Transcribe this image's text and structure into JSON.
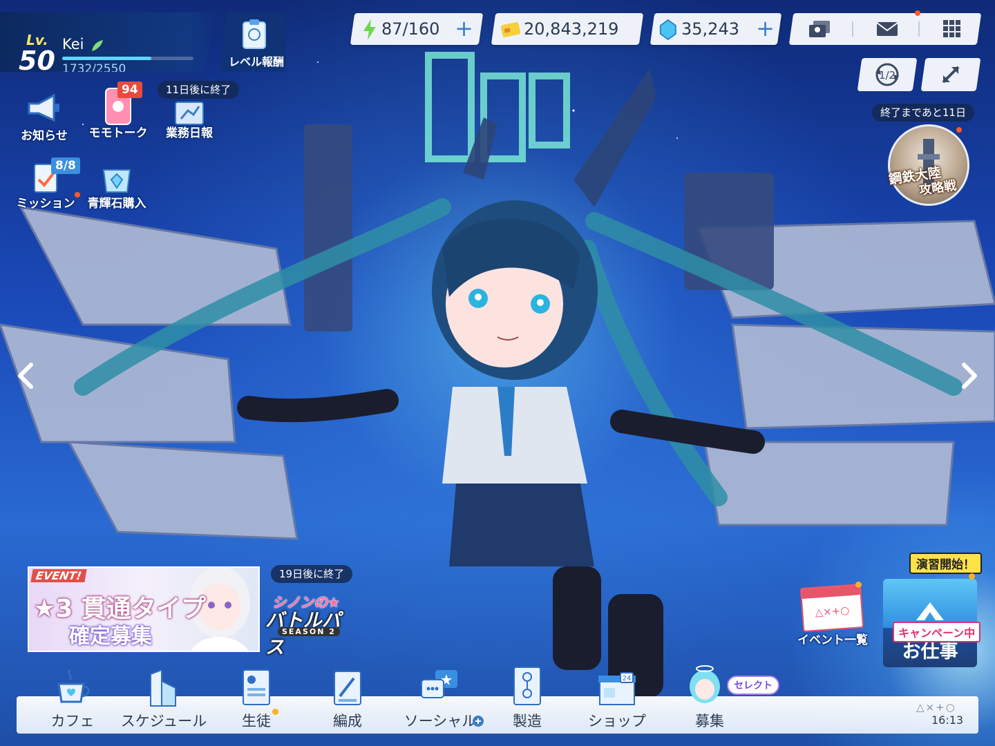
{
  "profile": {
    "lv_label": "Lv.",
    "level": "50",
    "name": "Kei",
    "exp_text": "1732/2550",
    "exp_fraction": 0.679
  },
  "level_reward": {
    "label": "レベル報酬"
  },
  "resources": {
    "ap": {
      "value": "87/160",
      "icon": "lightning-icon"
    },
    "credits": {
      "value": "20,843,219",
      "icon": "credit-card-icon"
    },
    "pyroxene": {
      "value": "35,243",
      "icon": "crystal-icon"
    }
  },
  "quick_icons": {
    "notice": {
      "label": "お知らせ"
    },
    "momotalk": {
      "label": "モモトーク",
      "badge": "94"
    },
    "daily_report": {
      "label": "業務日報",
      "pill": "11日後に終了"
    },
    "mission": {
      "label": "ミッション",
      "badge": "8/8"
    },
    "pyroxene_shop": {
      "label": "青輝石購入"
    }
  },
  "event_right": {
    "pill": "終了まであと11日",
    "title_1": "鋼鉄大陸",
    "title_2": "攻略戦"
  },
  "banner": {
    "tag": "EVENT!",
    "line1": "★3 貫通タイプ",
    "line2": "確定募集"
  },
  "battle_pass": {
    "pill": "19日後に終了",
    "line1": "シノンの★",
    "line2": "バトルパス",
    "season": "SEASON 2"
  },
  "event_list": {
    "label": "イベント一覧",
    "calendar_symbols": "△×+○"
  },
  "job": {
    "ribbon": "演習開始！",
    "campaign": "キャンペーン中",
    "label": "お仕事"
  },
  "nav": {
    "cafe": "カフェ",
    "schedule": "スケジュール",
    "students": "生徒",
    "formation": "編成",
    "social": "ソーシャル",
    "craft": "製造",
    "shop": "ショップ",
    "recruit": "募集",
    "recruit_tag": "セレクト",
    "shop_day": "24",
    "symbols": "△×+○",
    "time": "16:13"
  },
  "colors": {
    "accent_blue": "#3a7fc4",
    "alert_red": "#ea4a3c",
    "exp_bar": "#5fd6ff"
  }
}
